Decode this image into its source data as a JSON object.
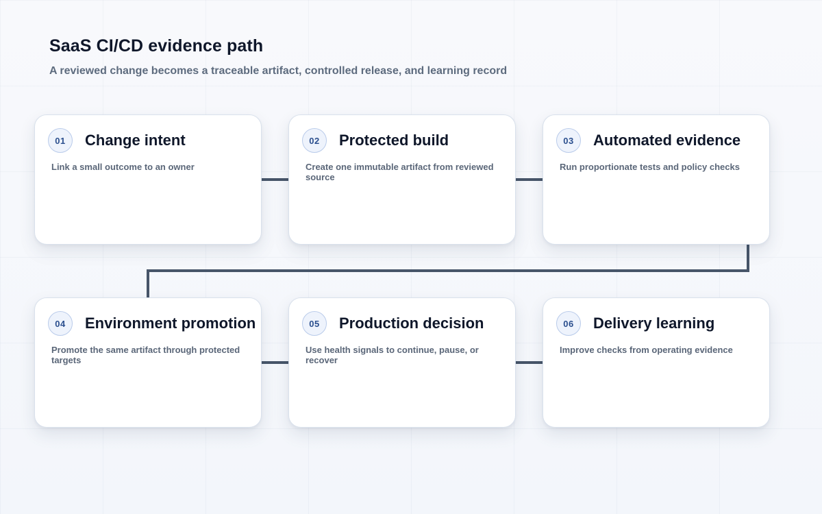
{
  "header": {
    "title": "SaaS CI/CD evidence path",
    "subtitle": "A reviewed change becomes a traceable artifact, controlled release, and learning record"
  },
  "steps": [
    {
      "number": "01",
      "title": "Change intent",
      "description": "Link a small outcome to an owner"
    },
    {
      "number": "02",
      "title": "Protected build",
      "description": "Create one immutable artifact from reviewed source"
    },
    {
      "number": "03",
      "title": "Automated evidence",
      "description": "Run proportionate tests and policy checks"
    },
    {
      "number": "04",
      "title": "Environment promotion",
      "description": "Promote the same artifact through protected targets"
    },
    {
      "number": "05",
      "title": "Production decision",
      "description": "Use health signals to continue, pause, or recover"
    },
    {
      "number": "06",
      "title": "Delivery learning",
      "description": "Improve checks from operating evidence"
    }
  ],
  "colors": {
    "connector": "#475569",
    "badge_text": "#2b4f8e",
    "title": "#0f172a",
    "description": "#5a6678"
  }
}
